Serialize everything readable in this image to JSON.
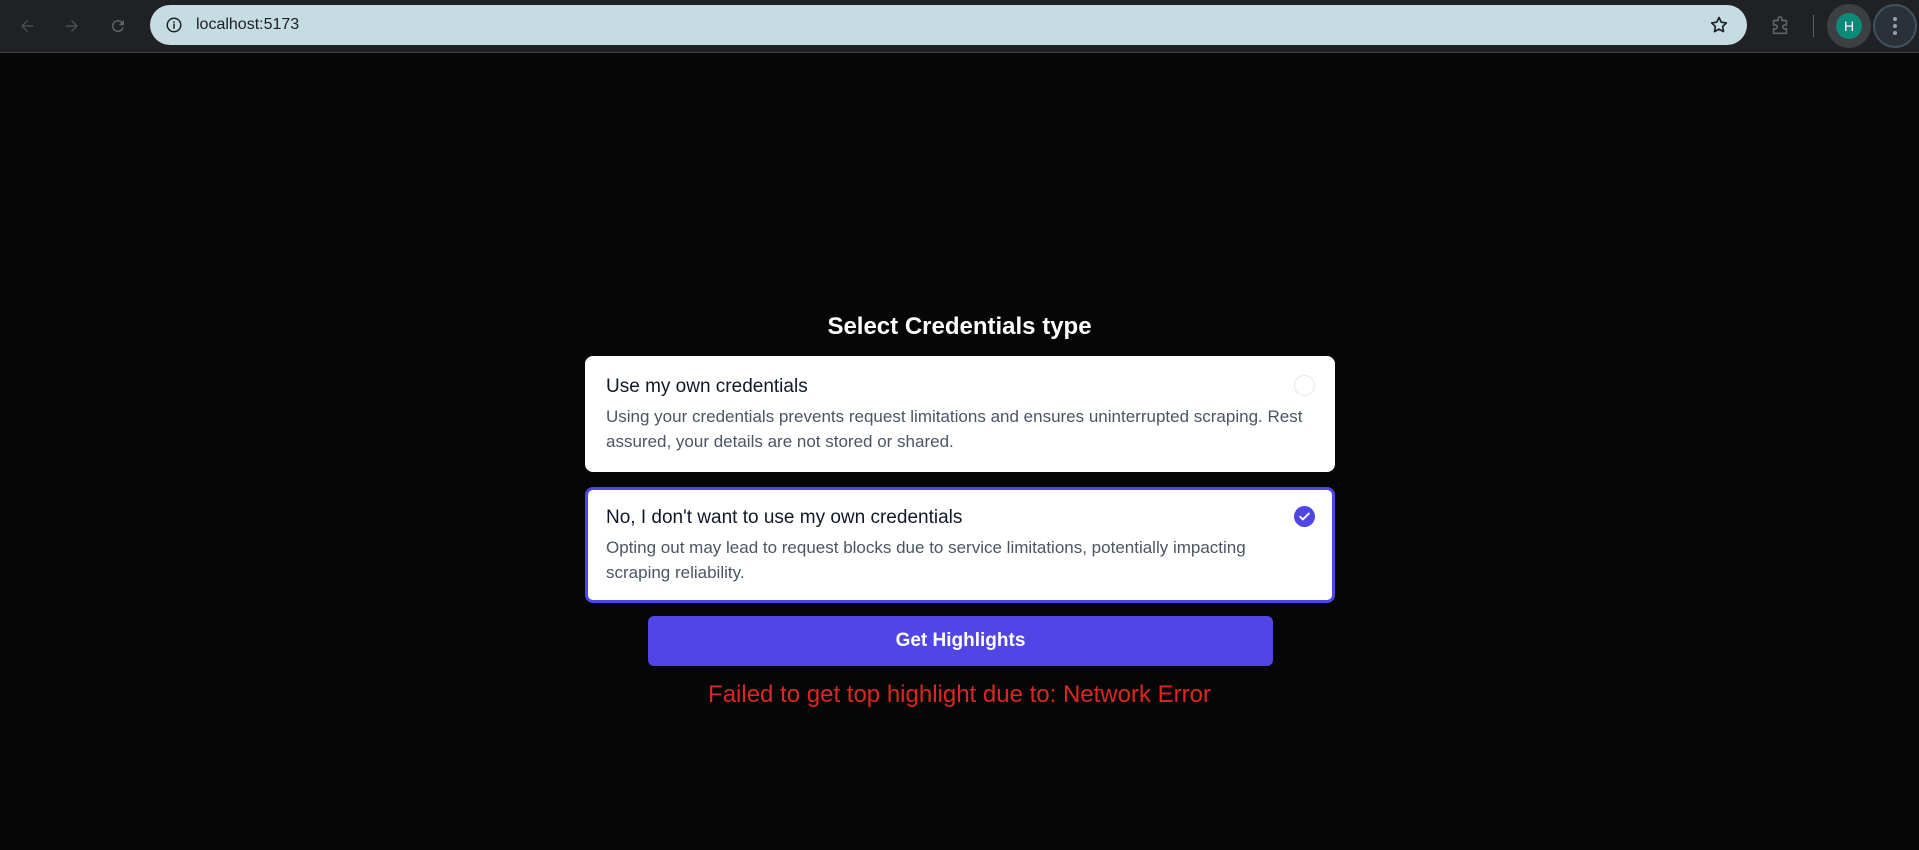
{
  "browser": {
    "url": "localhost:5173",
    "avatar_initial": "H"
  },
  "main": {
    "title": "Select Credentials type",
    "options": [
      {
        "title": "Use my own credentials",
        "description": "Using your credentials prevents request limitations and ensures uninterrupted scraping. Rest assured, your details are not stored or shared.",
        "selected": false
      },
      {
        "title": "No, I don't want to use my own credentials",
        "description": "Opting out may lead to request blocks due to service limitations, potentially impacting scraping reliability.",
        "selected": true
      }
    ],
    "button_label": "Get Highlights",
    "error_message": "Failed to get top highlight due to: Network Error"
  },
  "colors": {
    "accent": "#4f46e5",
    "error": "#dc2626",
    "background": "#060606"
  }
}
